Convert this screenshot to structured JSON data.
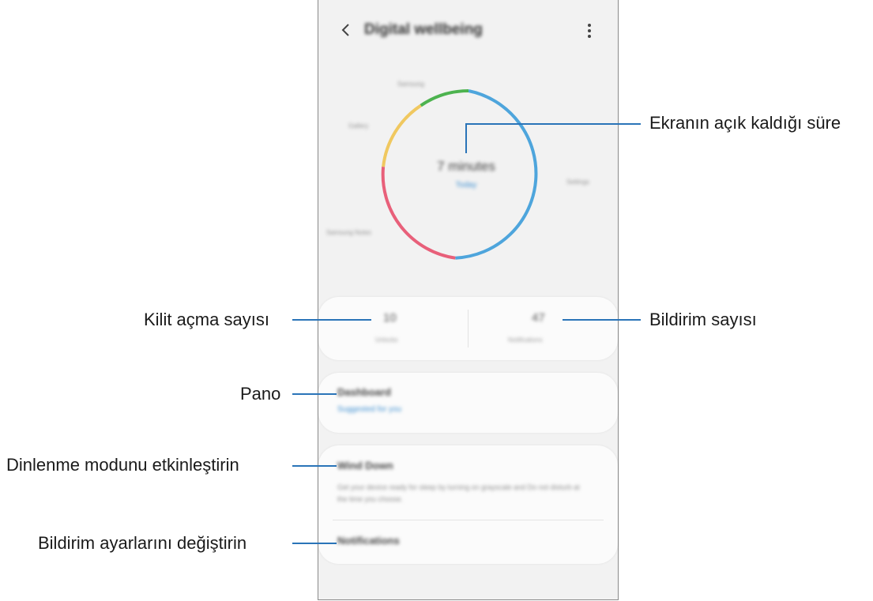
{
  "screen": {
    "title": "Digital wellbeing",
    "screen_time": "7 minutes",
    "today_label": "Today",
    "categories": [
      "Settings",
      "Gallery",
      "Samsung",
      "Samsung Notes"
    ],
    "unlocks": {
      "value": "10",
      "label": "Unlocks"
    },
    "notifications": {
      "value": "47",
      "label": "Notifications"
    },
    "dashboard": {
      "title": "Dashboard",
      "subtitle": "Suggested for you"
    },
    "wind_down": {
      "title": "Wind Down",
      "description": "Get your device ready for sleep by turning on grayscale and Do not disturb at the time you choose."
    },
    "notifications_item": {
      "title": "Notifications"
    }
  },
  "donut_segments": [
    {
      "color": "#4ea5dc",
      "label": "Settings"
    },
    {
      "color": "#e8607a",
      "label": "Samsung Notes"
    },
    {
      "color": "#f0c860",
      "label": "Gallery"
    },
    {
      "color": "#4db34f",
      "label": "Samsung"
    }
  ],
  "callouts": {
    "screen_time": "Ekranın açık kaldığı süre",
    "unlocks": "Kilit açma sayısı",
    "notifications": "Bildirim sayısı",
    "dashboard": "Pano",
    "wind_down": "Dinlenme modunu etkinleştirin",
    "notification_settings": "Bildirim ayarlarını değiştirin"
  }
}
